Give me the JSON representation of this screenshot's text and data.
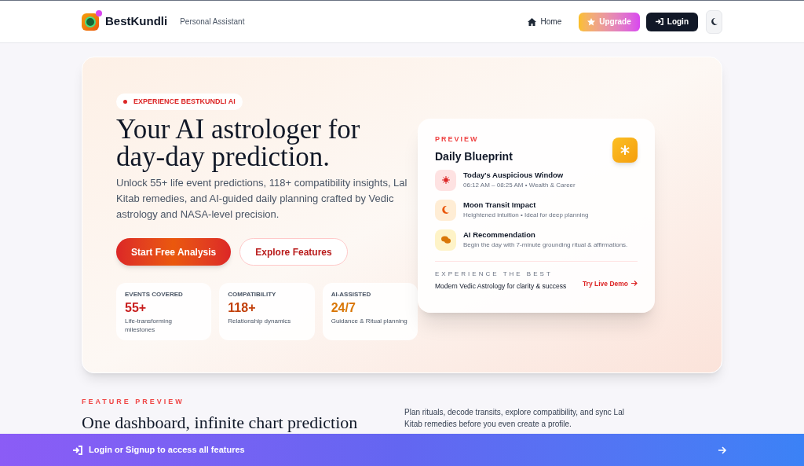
{
  "header": {
    "brand": "BestKundli",
    "tagline": "Personal Assistant",
    "nav": [
      {
        "kind": "home",
        "label": "Home"
      },
      {
        "kind": "upgrade",
        "label": "Upgrade"
      },
      {
        "kind": "login",
        "label": "Login"
      },
      {
        "kind": "theme"
      }
    ]
  },
  "hero": {
    "badge": "EXPERIENCE BESTKUNDLI AI",
    "title_lines": [
      "Your AI astrologer for",
      "day-day prediction."
    ],
    "description": "Unlock 55+ life event predictions, 118+ compatibility insights, Lal Kitab remedies, and AI-guided daily planning crafted by Vedic astrology and NASA-level precision.",
    "primary_button": "Start Free Analysis",
    "secondary_button": "Explore Features",
    "stats": [
      {
        "label": "EVENTS COVERED",
        "value": "55+",
        "color": "#c81e1e",
        "caption": "Life-transforming milestones"
      },
      {
        "label": "COMPATIBILITY",
        "value": "118+",
        "color": "#c2410c",
        "caption": "Relationship dynamics"
      },
      {
        "label": "AI-ASSISTED",
        "value": "24/7",
        "color": "#d97706",
        "caption": "Guidance & Ritual planning"
      }
    ]
  },
  "preview_card": {
    "eyebrow": "PREVIEW",
    "title": "Daily Blueprint",
    "items": [
      {
        "kind": "sun",
        "title": "Today's Auspicious Window",
        "detail": "06:12 AM – 08:25 AM • Wealth & Career"
      },
      {
        "kind": "moon",
        "title": "Moon Transit Impact",
        "detail": "Heightened intuition • Ideal for deep planning"
      },
      {
        "kind": "chat",
        "title": "AI Recommendation",
        "detail": "Begin the day with 7-minute grounding ritual & affirmations."
      }
    ],
    "footer_eyebrow": "EXPERIENCE THE BEST",
    "footer_text": "Modern Vedic Astrology for clarity & success",
    "link": "Try Live Demo"
  },
  "feature_preview": {
    "eyebrow": "FEATURE PREVIEW",
    "title": "One dashboard, infinite chart prediction",
    "description": "Plan rituals, decode transits, explore compatibility, and sync Lal Kitab remedies before you even create a profile."
  },
  "banner": {
    "text": "Login or Signup to access all features"
  }
}
